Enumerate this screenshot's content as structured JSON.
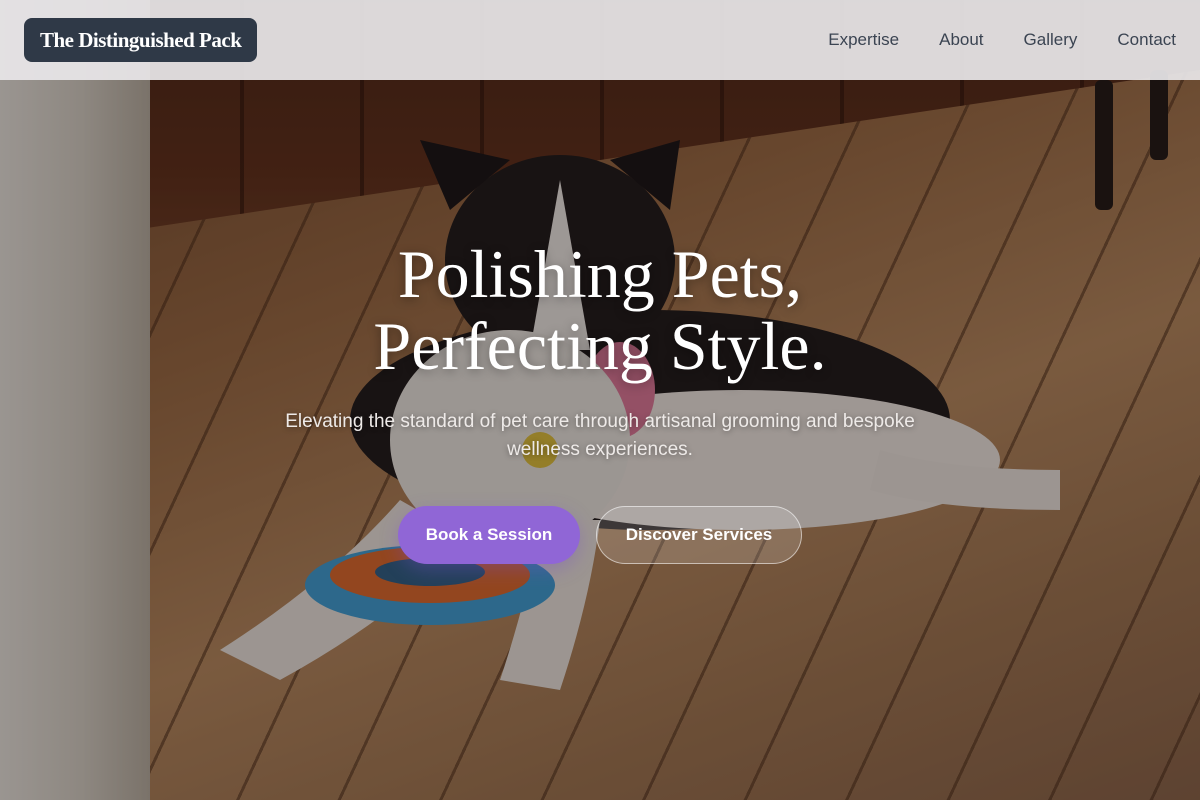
{
  "brand": {
    "logo_text": "The Distinguished Pack"
  },
  "nav": {
    "items": [
      {
        "label": "Expertise"
      },
      {
        "label": "About"
      },
      {
        "label": "Gallery"
      },
      {
        "label": "Contact"
      }
    ]
  },
  "hero": {
    "title_line1": "Polishing Pets,",
    "title_line2": "Perfecting Style.",
    "subtitle": "Elevating the standard of pet care through artisanal grooming and bespoke wellness experiences.",
    "primary_cta": "Book a Session",
    "secondary_cta": "Discover Services",
    "background_image": "dog-on-wooden-floor-photo"
  },
  "colors": {
    "logo_bg": "#2f3947",
    "primary_button": "#9066d6",
    "header_bg": "#e8e6e8",
    "nav_text": "#3b4452"
  }
}
